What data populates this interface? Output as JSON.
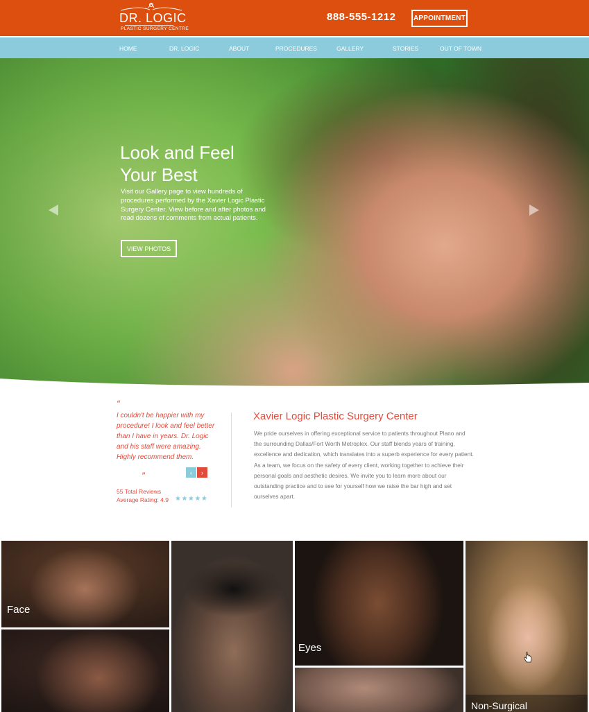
{
  "header": {
    "logo_name": "DR. LOGIC",
    "logo_sub": "PLASTIC SURGERY CENTRE",
    "phone": "888-555-1212",
    "appointment_label": "APPOINTMENT",
    "bg_color": "#dc4f0f"
  },
  "nav": {
    "items": [
      "HOME",
      "DR. LOGIC",
      "ABOUT",
      "PROCEDURES",
      "GALLERY",
      "STORIES",
      "OUT OF TOWN"
    ],
    "bg_color": "#8ccbdb"
  },
  "hero": {
    "title_line1": "Look and Feel",
    "title_line2": "Your Best",
    "text": "Visit our Gallery page to view hundreds of procedures performed by the Xavier Logic Plastic Surgery Center.  View before and after photos and read dozens of comments from actual patients.",
    "button_label": "VIEW PHOTOS",
    "prev_icon": "triangle-left",
    "next_icon": "triangle-right"
  },
  "testimonial": {
    "open_quote": "“",
    "text": "I couldn't be happier with my procedure!  I look and feel better than I have in years.  Dr. Logic and his staff were amazing. Highly recommend them.",
    "close_quote": "”",
    "prev_label": "‹",
    "next_label": "›",
    "reviews_count": "55",
    "reviews_label": "Total Reviews",
    "rating_text": "Average Rating: 4.9",
    "stars": "★★★★★",
    "accent_color": "#e24a3a"
  },
  "about": {
    "title": "Xavier Logic Plastic Surgery Center",
    "text": "We pride ourselves in offering exceptional service to patients throughout Plano and the surrounding Dallas/Fort Worth Metroplex. Our staff blends years of training, excellence and dedication, which translates into a superb experience for every patient. As a team, we focus on the safety of every client, working together to achieve their personal goals and aesthetic desires. We invite you to learn more about our outstanding practice and to see for yourself how we raise the bar high and set ourselves apart."
  },
  "procedures": {
    "face": "Face",
    "eyes": "Eyes",
    "non_surgical": "Non-Surgical"
  }
}
